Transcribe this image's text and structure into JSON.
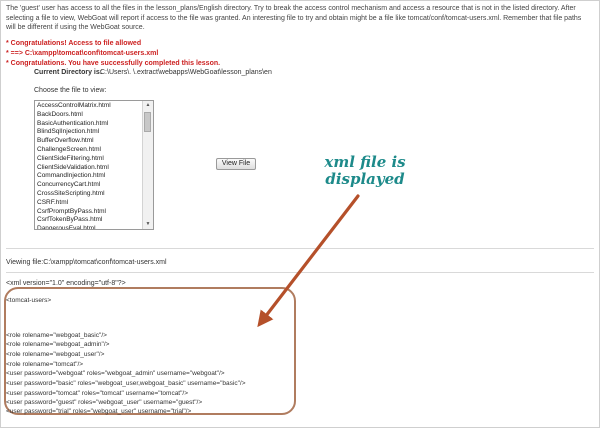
{
  "intro": "The 'guest' user has access to all the files in the lesson_plans/English directory. Try to break the access control mechanism and access a resource that is not in the listed directory. After selecting a file to view, WebGoat will report if access to the file was granted. An interesting file to try and obtain might be a file like tomcat/conf/tomcat-users.xml. Remember that file paths will be different if using the WebGoat source.",
  "messages": [
    "* Congratulations! Access to file allowed",
    "* ==> C:\\xampp\\tomcat\\conf\\tomcat-users.xml",
    "* Congratulations. You have successfully completed this lesson."
  ],
  "current_directory": {
    "label": "Current Directory is:",
    "value": "C:\\Users\\.                 \\.extract\\webapps\\WebGoat\\lesson_plans\\en"
  },
  "choose_label": "Choose the file to view:",
  "files": [
    "AccessControlMatrix.html",
    "BackDoors.html",
    "BasicAuthentication.html",
    "BlindSqlInjection.html",
    "BufferOverflow.html",
    "ChallengeScreen.html",
    "ClientSideFiltering.html",
    "ClientSideValidation.html",
    "CommandInjection.html",
    "ConcurrencyCart.html",
    "CrossSiteScripting.html",
    "CSRF.html",
    "CsrfPromptByPass.html",
    "CsrfTokenByPass.html",
    "DangerousEval.html"
  ],
  "view_button": "View File",
  "viewing_text": "Viewing file:C:\\xampp\\tomcat\\conf\\tomcat-users.xml",
  "xml_declaration": "<xml version=\"1.0\" encoding=\"utf-8\"?>",
  "xml_lines": [
    "<tomcat-users>",
    "<role rolename=\"webgoat_basic\"/>",
    "<role rolename=\"webgoat_admin\"/>",
    "<role rolename=\"webgoat_user\"/>",
    "<role rolename=\"tomcat\"/>",
    "<user password=\"webgoat\" roles=\"webgoat_admin\" username=\"webgoat\"/>",
    "<user password=\"basic\" roles=\"webgoat_user,webgoat_basic\" username=\"basic\"/>",
    "<user password=\"tomcat\" roles=\"tomcat\" username=\"tomcat\"/>",
    "<user password=\"guest\" roles=\"webgoat_user\" username=\"guest\"/>",
    "<user password=\"trial\" roles=\"webgoat_user\" username=\"trial\"/>"
  ],
  "annotation": "xml file is displayed",
  "colors": {
    "message": "#cc2222",
    "annotation": "#1d8a8a",
    "arrow": "#b5502a",
    "highlight_border": "#b07c5f"
  }
}
